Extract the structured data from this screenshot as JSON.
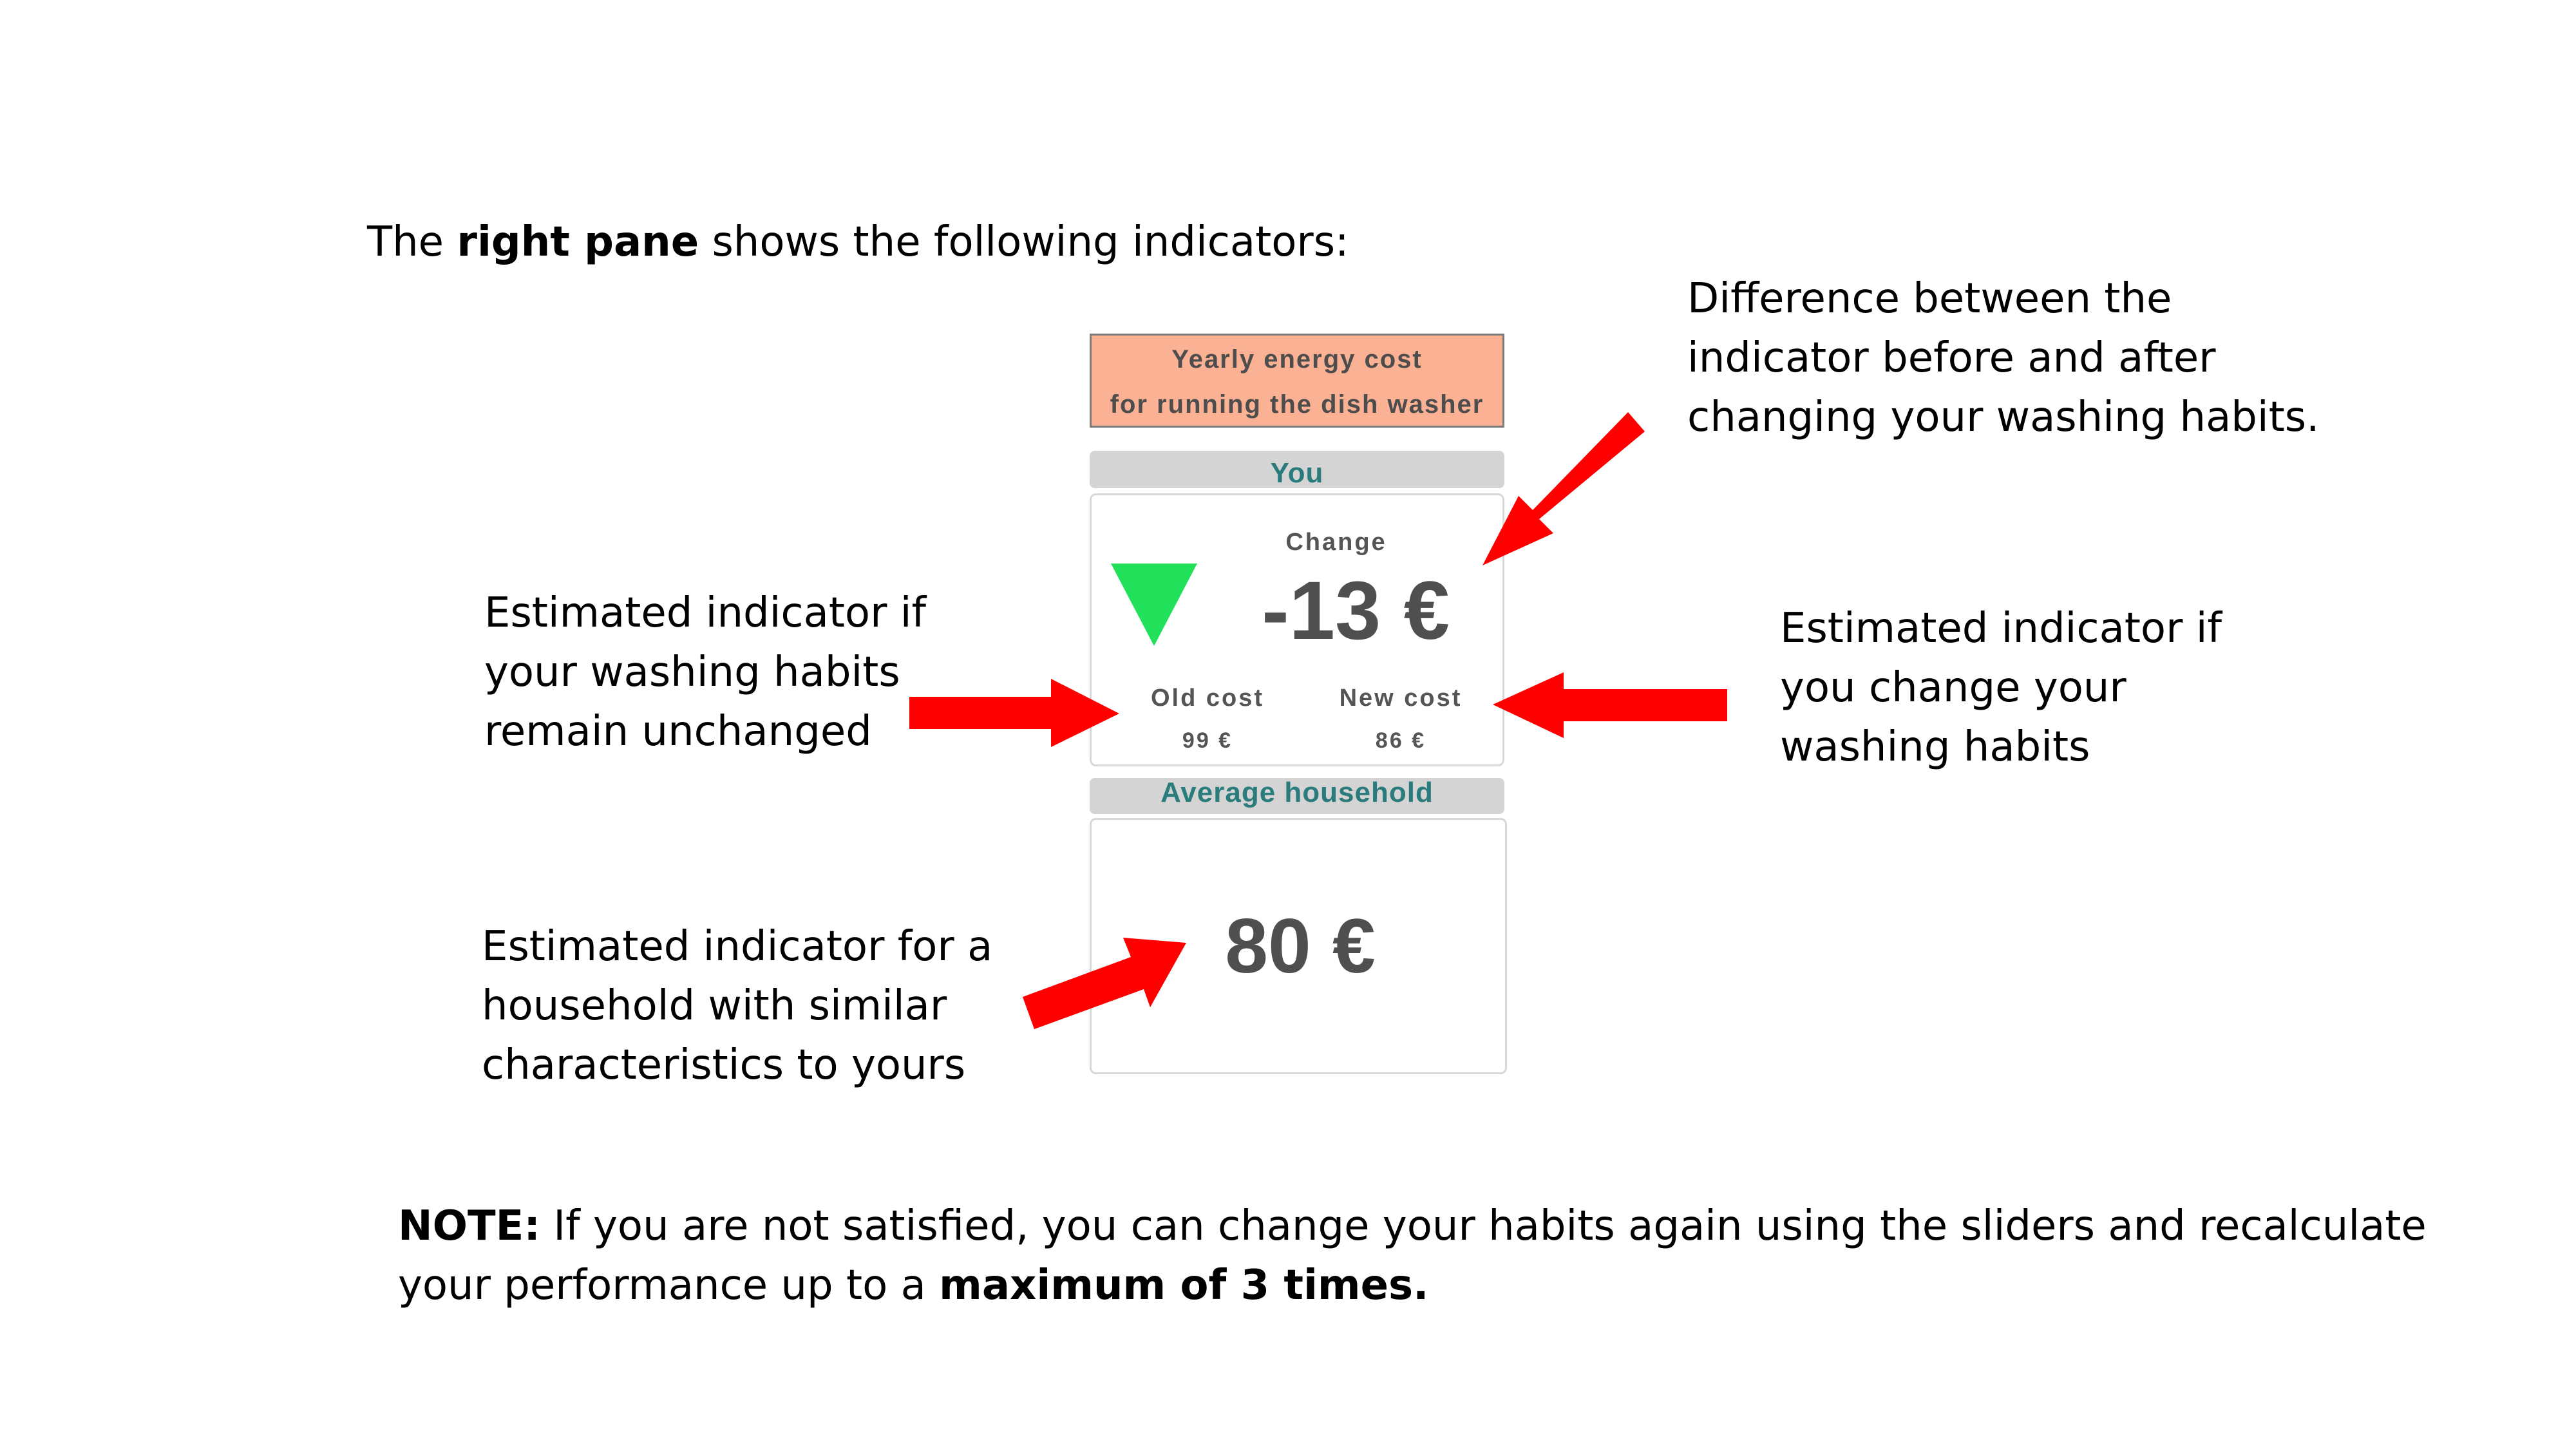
{
  "intro": {
    "prefix": "The ",
    "bold": "right pane",
    "suffix": " shows the following indicators:"
  },
  "pane": {
    "header_line1": "Yearly energy cost",
    "header_line2": "for running the dish washer",
    "you_label": "You",
    "change_label": "Change",
    "change_value": "-13 €",
    "old_cost_label": "Old cost",
    "old_cost_value": "99 €",
    "new_cost_label": "New cost",
    "new_cost_value": "86 €",
    "average_label": "Average household",
    "average_value": "80 €",
    "change_indicator_icon": "green-down-triangle-icon"
  },
  "annotations": {
    "difference": [
      "Difference between the",
      "indicator before and after",
      "changing your washing habits."
    ],
    "unchanged": [
      "Estimated indicator if",
      "your washing habits",
      "remain unchanged"
    ],
    "changed": [
      "Estimated indicator if",
      "you change your",
      "washing habits"
    ],
    "similar": [
      "Estimated indicator for a",
      "household with similar",
      "characteristics to yours"
    ]
  },
  "note": {
    "label": "NOTE:",
    "text_line1": " If you are not satisfied, you can change your habits again using the sliders and recalculate",
    "text_line2": "your performance up to a ",
    "bold_end": "maximum of 3 times."
  },
  "colors": {
    "arrow": "#ff0000",
    "header_bg": "#fbb194",
    "section_bar_bg": "#d4d4d4",
    "section_text": "#2a7b7b",
    "down_triangle": "#22e05a",
    "value_text": "#4f4f4f"
  }
}
